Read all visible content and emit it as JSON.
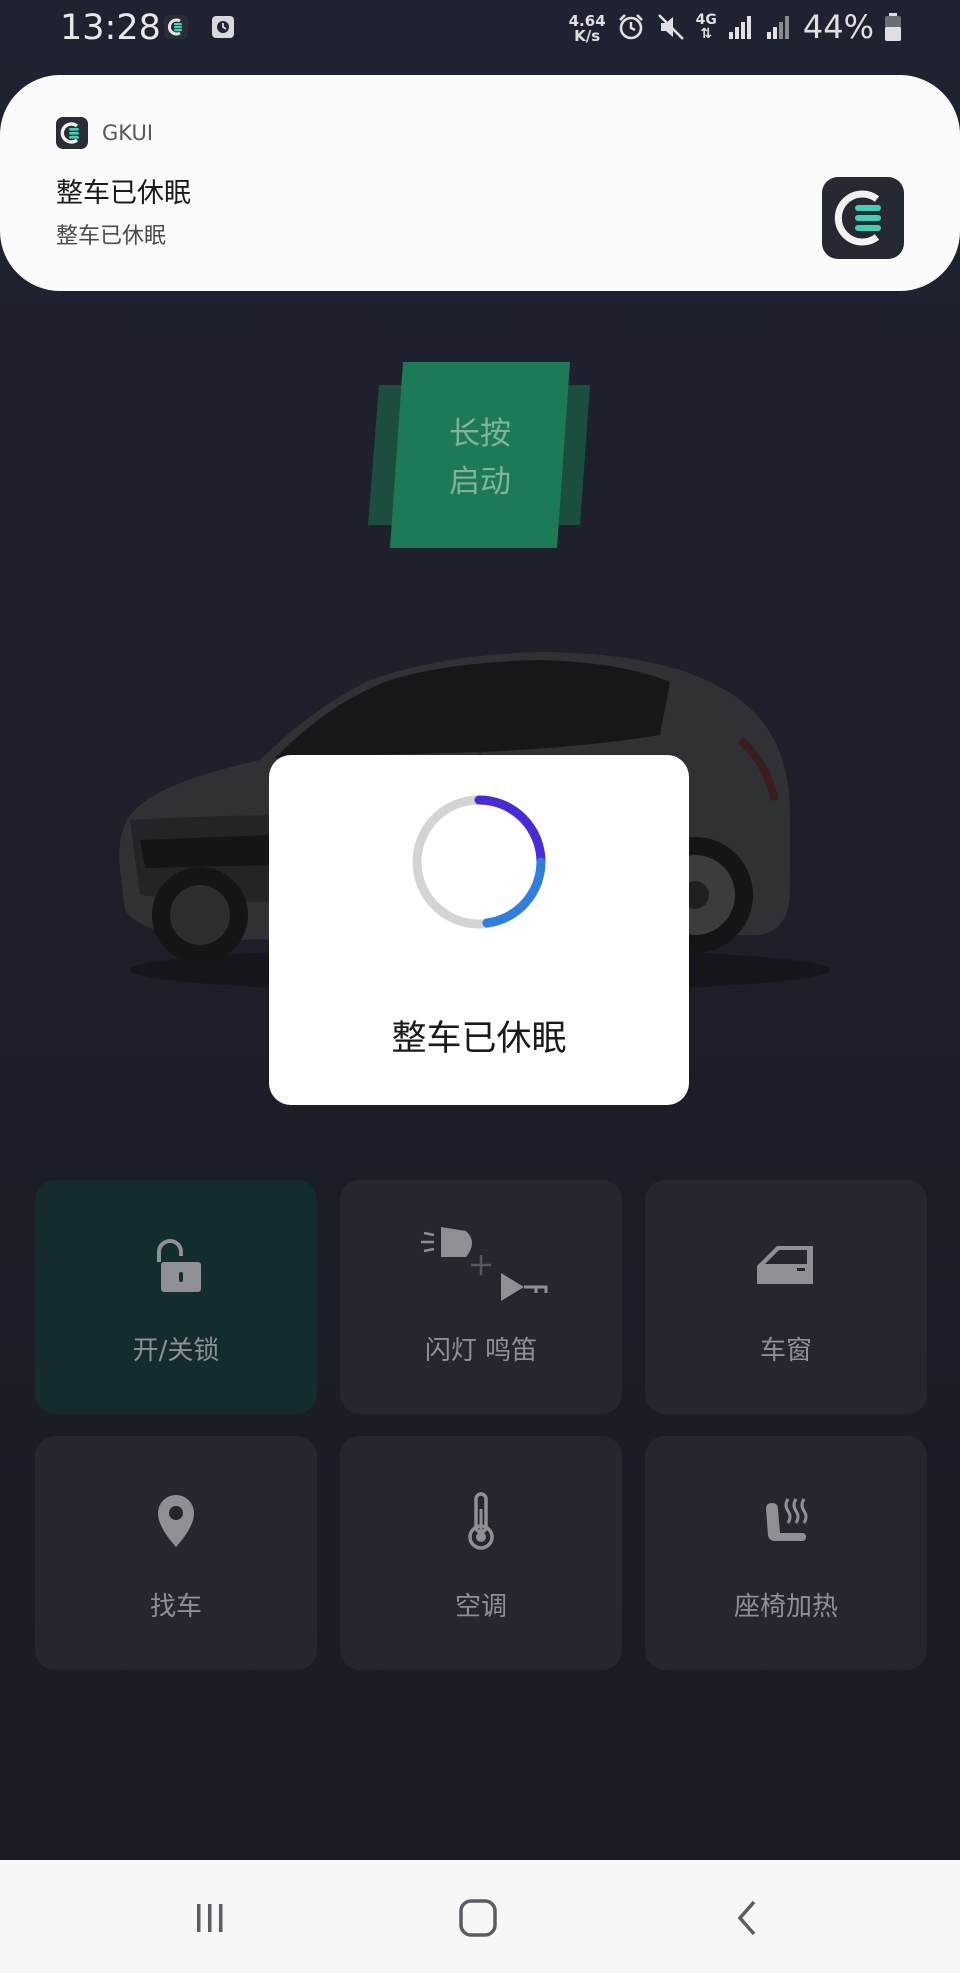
{
  "status_bar": {
    "time": "13:28",
    "net_speed_value": "4.64",
    "net_speed_unit": "K/s",
    "network_type": "4G",
    "battery": "44%"
  },
  "notification": {
    "app_name": "GKUI",
    "title": "整车已休眠",
    "body": "整车已休眠"
  },
  "start_button": {
    "line1": "长按",
    "line2": "启动"
  },
  "modal": {
    "message": "整车已休眠"
  },
  "controls": [
    {
      "label": "开/关锁",
      "icon": "unlock-icon",
      "active": true
    },
    {
      "label": "闪灯 鸣笛",
      "icon": "light-horn-icon",
      "active": false
    },
    {
      "label": "车窗",
      "icon": "window-icon",
      "active": false
    },
    {
      "label": "找车",
      "icon": "location-pin-icon",
      "active": false
    },
    {
      "label": "空调",
      "icon": "thermometer-icon",
      "active": false
    },
    {
      "label": "座椅加热",
      "icon": "seat-heat-icon",
      "active": false
    }
  ],
  "colors": {
    "background": "#1d1f29",
    "accent_green": "#1d7a56",
    "active_tile": "#132c2e",
    "tile": "#25272e",
    "spinner_blue": "#2f7fe0",
    "spinner_purple": "#4a2ad8"
  }
}
